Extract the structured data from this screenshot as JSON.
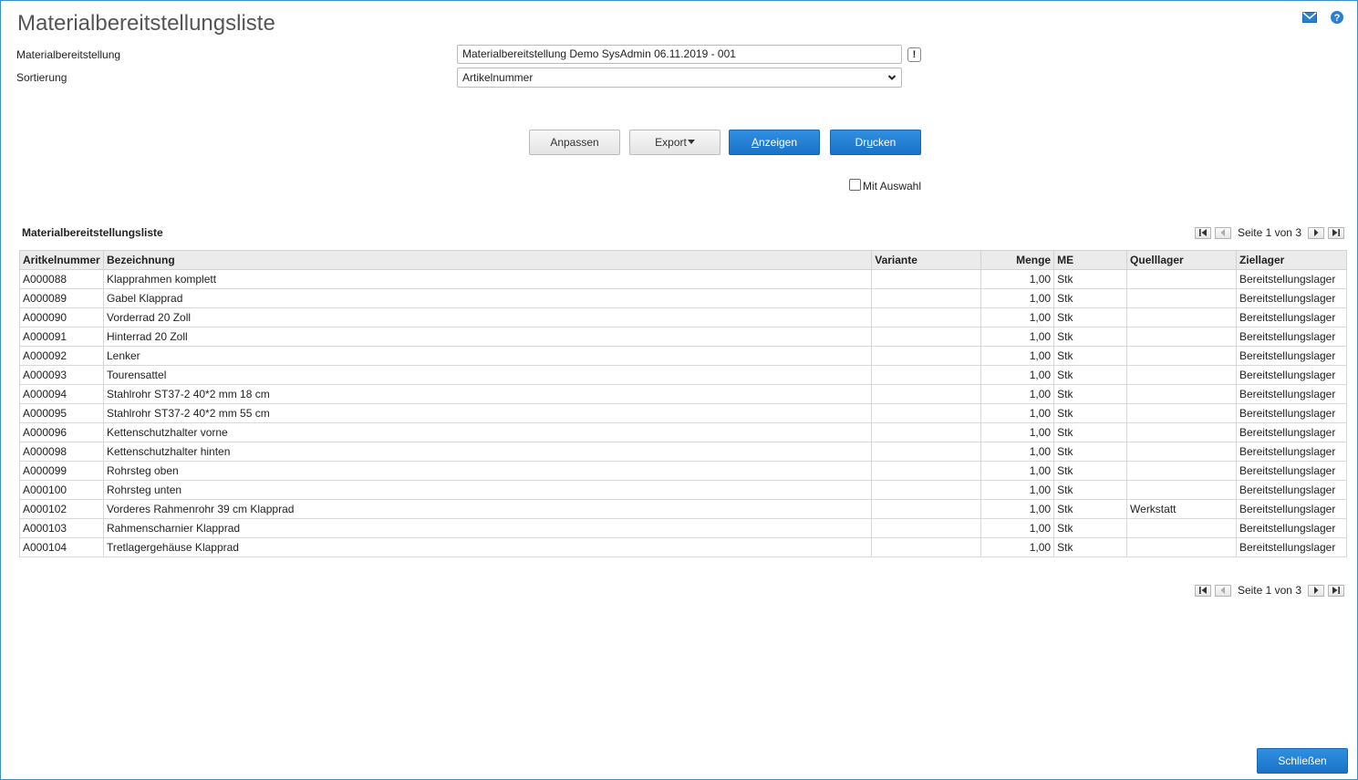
{
  "title": "Materialbereitstellungsliste",
  "icons": {
    "mail": "mail-icon",
    "help": "help-icon"
  },
  "form": {
    "materialbereitstellung_label": "Materialbereitstellung",
    "materialbereitstellung_value": "Materialbereitstellung Demo SysAdmin 06.11.2019 - 001",
    "excl_label": "!",
    "sortierung_label": "Sortierung",
    "sortierung_value": "Artikelnummer"
  },
  "buttons": {
    "anpassen": "Anpassen",
    "export": "Export",
    "anzeigen_ul": "A",
    "anzeigen_rest": "nzeigen",
    "drucken_pre": "Dr",
    "drucken_ul": "u",
    "drucken_rest": "cken",
    "schliessen": "Schließen"
  },
  "checkbox": {
    "label": "Mit Auswahl",
    "checked": false
  },
  "section_title": "Materialbereitstellungsliste",
  "pager": {
    "text": "Seite 1 von 3"
  },
  "table": {
    "headers": [
      "Aritkelnummer",
      "Bezeichnung",
      "Variante",
      "Menge",
      "ME",
      "Quelllager",
      "Ziellager"
    ],
    "rows": [
      [
        "A000088",
        "Klapprahmen komplett",
        "",
        "1,00",
        "Stk",
        "",
        "Bereitstellungslager"
      ],
      [
        "A000089",
        "Gabel Klapprad",
        "",
        "1,00",
        "Stk",
        "",
        "Bereitstellungslager"
      ],
      [
        "A000090",
        "Vorderrad 20 Zoll",
        "",
        "1,00",
        "Stk",
        "",
        "Bereitstellungslager"
      ],
      [
        "A000091",
        "Hinterrad 20 Zoll",
        "",
        "1,00",
        "Stk",
        "",
        "Bereitstellungslager"
      ],
      [
        "A000092",
        "Lenker",
        "",
        "1,00",
        "Stk",
        "",
        "Bereitstellungslager"
      ],
      [
        "A000093",
        "Tourensattel",
        "",
        "1,00",
        "Stk",
        "",
        "Bereitstellungslager"
      ],
      [
        "A000094",
        "Stahlrohr ST37-2 40*2 mm 18 cm",
        "",
        "1,00",
        "Stk",
        "",
        "Bereitstellungslager"
      ],
      [
        "A000095",
        "Stahlrohr ST37-2 40*2 mm 55 cm",
        "",
        "1,00",
        "Stk",
        "",
        "Bereitstellungslager"
      ],
      [
        "A000096",
        "Kettenschutzhalter vorne",
        "",
        "1,00",
        "Stk",
        "",
        "Bereitstellungslager"
      ],
      [
        "A000098",
        "Kettenschutzhalter hinten",
        "",
        "1,00",
        "Stk",
        "",
        "Bereitstellungslager"
      ],
      [
        "A000099",
        "Rohrsteg oben",
        "",
        "1,00",
        "Stk",
        "",
        "Bereitstellungslager"
      ],
      [
        "A000100",
        "Rohrsteg unten",
        "",
        "1,00",
        "Stk",
        "",
        "Bereitstellungslager"
      ],
      [
        "A000102",
        "Vorderes Rahmenrohr 39 cm Klapprad",
        "",
        "1,00",
        "Stk",
        "Werkstatt",
        "Bereitstellungslager"
      ],
      [
        "A000103",
        "Rahmenscharnier Klapprad",
        "",
        "1,00",
        "Stk",
        "",
        "Bereitstellungslager"
      ],
      [
        "A000104",
        "Tretlagergehäuse Klapprad",
        "",
        "1,00",
        "Stk",
        "",
        "Bereitstellungslager"
      ]
    ]
  },
  "colors": {
    "accent": "#1a72c7",
    "frame": "#3a8fc7",
    "header_bg": "#ebebeb"
  }
}
